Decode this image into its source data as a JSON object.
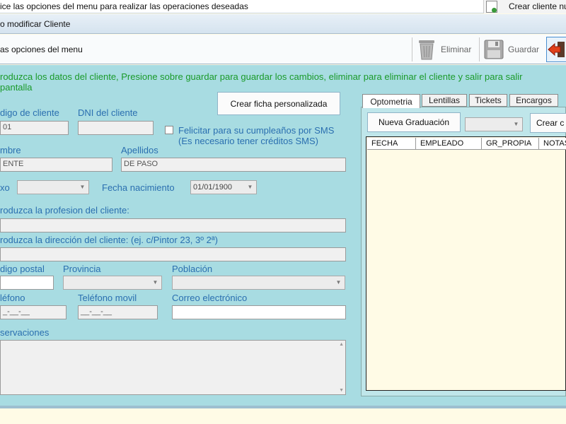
{
  "top_hint": "ice las opciones del menu para realizar las operaciones deseadas",
  "top_right_button": "Crear cliente nu",
  "window_title": "o modificar Cliente",
  "toolbar": {
    "hint": "as opciones del menu",
    "eliminar": "Eliminar",
    "guardar": "Guardar"
  },
  "instruction_line1": "roduzca los datos del cliente, Presione sobre guardar para guardar los cambios, eliminar para eliminar el cliente y salir para salir",
  "instruction_line2": "pantalla",
  "form": {
    "crear_ficha": "Crear ficha personalizada",
    "codigo_label": "digo de cliente",
    "codigo_value": "01",
    "dni_label": "DNI del cliente",
    "dni_value": "",
    "sms_label": "Felicitar para su cumpleaños por SMS",
    "sms_note": "(Es necesario tener créditos SMS)",
    "nombre_label": "mbre",
    "nombre_value": "ENTE",
    "apellidos_label": "Apellidos",
    "apellidos_value": "DE PASO",
    "sexo_label": "xo",
    "fecha_label": "Fecha nacimiento",
    "fecha_value": "01/01/1900",
    "profesion_label": "roduzca la profesion del cliente:",
    "direccion_label": "roduzca la dirección del cliente: (ej. c/Pintor 23, 3º 2ª)",
    "cp_label": "digo postal",
    "provincia_label": "Provincia",
    "poblacion_label": "Población",
    "telefono_label": "léfono",
    "telefono_value": "_-__-__",
    "movil_label": "Teléfono movil",
    "movil_value": "__-__-__",
    "correo_label": "Correo electrónico",
    "observaciones_label": "servaciones"
  },
  "tabs": [
    "Optometria",
    "Lentillas",
    "Tickets",
    "Encargos"
  ],
  "right": {
    "nueva_graduacion": "Nueva Graduación",
    "crear": "Crear c",
    "columns": [
      "FECHA",
      "EMPLEADO",
      "GR_PROPIA",
      "NOTAS"
    ]
  },
  "icons": {
    "eliminar": "trash-icon",
    "guardar": "floppy-disk-icon",
    "salir": "exit-arrow-icon",
    "crear_cliente": "new-document-icon"
  },
  "colors": {
    "panel_bg": "#a8dce2",
    "instruction_text": "#1a9a2a",
    "label_text": "#2a6fb0"
  }
}
